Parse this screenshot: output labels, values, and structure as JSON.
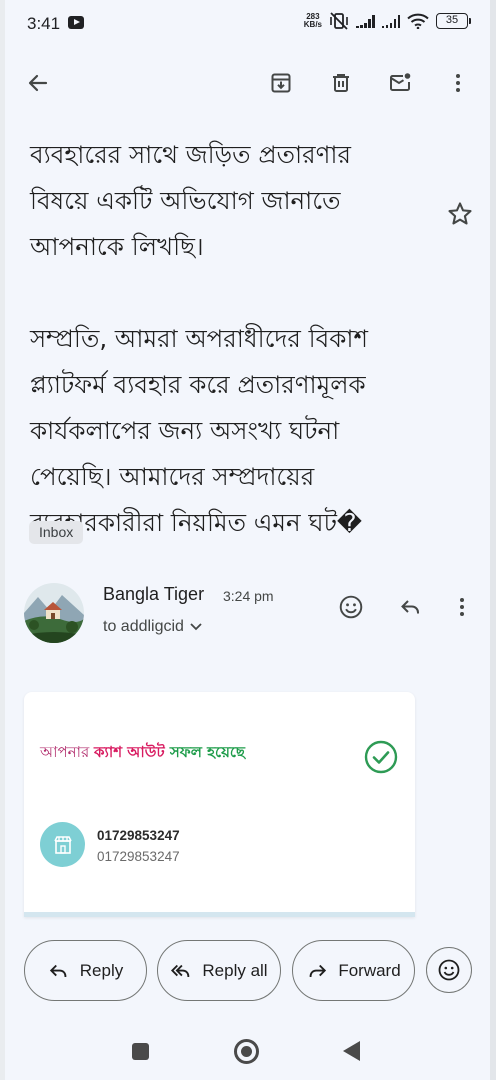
{
  "status_bar": {
    "time": "3:41",
    "net_speed_value": "283",
    "net_speed_unit": "KB/s",
    "battery": "35"
  },
  "toolbar": {
    "icons": [
      "back-arrow-icon",
      "archive-icon",
      "delete-icon",
      "mark-unread-icon",
      "more-vert-icon"
    ]
  },
  "message": {
    "snippet_lines_1": [
      "ব্যবহারের সাথে জড়িত প্রতারণার",
      "বিষয়ে একটি অভিযোগ জানাতে",
      "আপনাকে লিখছি।"
    ],
    "snippet_lines_2": [
      "সম্প্রতি, আমরা অপরাধীদের বিকাশ",
      "প্ল্যাটফর্ম ব্যবহার করে প্রতারণামূলক",
      "কার্যকলাপের জন্য অসংখ্য ঘটনা",
      "পেয়েছি। আমাদের সম্প্রদায়ের",
      "ব্যবহারকারীরা নিয়মিত এমন ঘট�"
    ],
    "label": "Inbox"
  },
  "sender": {
    "name": "Bangla Tiger",
    "time": "3:24 pm",
    "to": "to addligcid"
  },
  "card": {
    "headline_part1": "আপনার ",
    "headline_part2": "ক্যাশ আউট",
    "headline_part3": " সফল হয়েছে",
    "number_primary": "01729853247",
    "number_secondary": "01729853247",
    "colors": {
      "pink": "#d81b60",
      "green": "#1e9c4a",
      "teal": "#7ecfd4"
    }
  },
  "actions": {
    "reply": "Reply",
    "reply_all": "Reply all",
    "forward": "Forward"
  }
}
